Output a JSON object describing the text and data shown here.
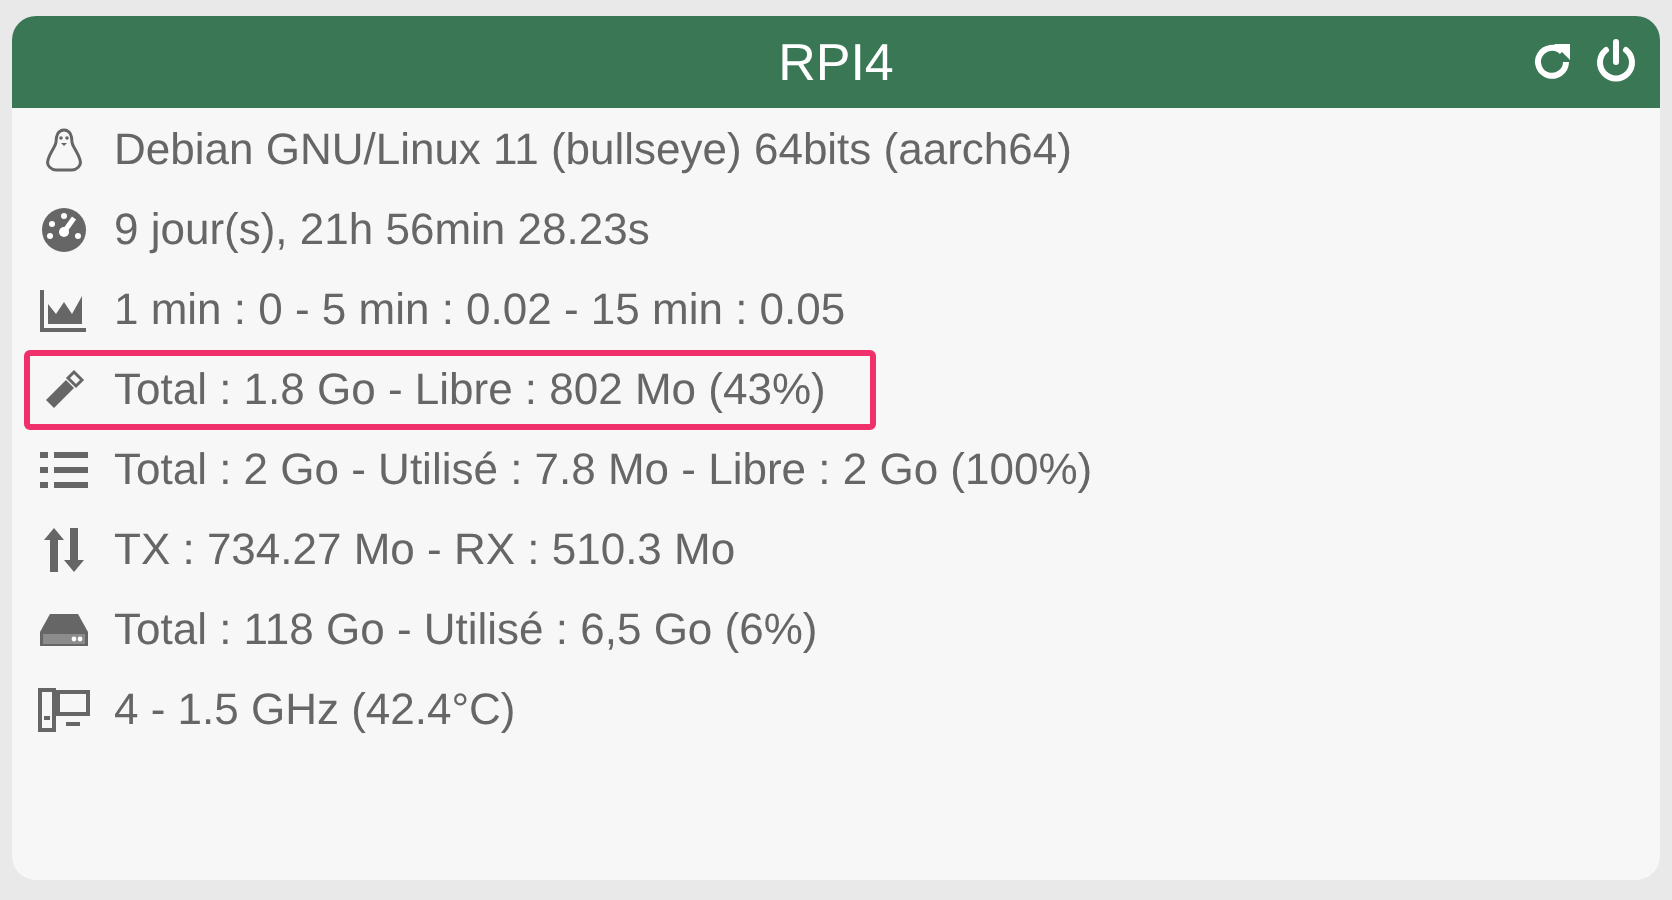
{
  "header": {
    "title": "RPI4"
  },
  "rows": [
    {
      "kind": "os",
      "text": "Debian GNU/Linux 11 (bullseye) 64bits (aarch64)",
      "highlighted": false
    },
    {
      "kind": "uptime",
      "text": "9 jour(s), 21h 56min 28.23s",
      "highlighted": false
    },
    {
      "kind": "load",
      "text": "1 min : 0 - 5 min : 0.02 - 15 min : 0.05",
      "highlighted": false
    },
    {
      "kind": "memory",
      "text": "Total : 1.8 Go - Libre : 802 Mo (43%)",
      "highlighted": true
    },
    {
      "kind": "swap",
      "text": "Total : 2 Go - Utilisé : 7.8 Mo - Libre : 2 Go (100%)",
      "highlighted": false
    },
    {
      "kind": "network",
      "text": "TX : 734.27 Mo - RX : 510.3 Mo",
      "highlighted": false
    },
    {
      "kind": "disk",
      "text": "Total : 118 Go - Utilisé : 6,5 Go (6%)",
      "highlighted": false
    },
    {
      "kind": "cpu",
      "text": "4 - 1.5 GHz (42.4°C)",
      "highlighted": false
    }
  ]
}
